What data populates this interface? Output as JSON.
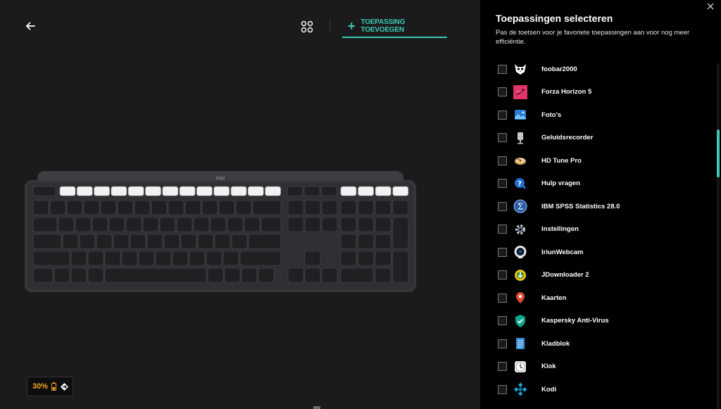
{
  "header": {
    "add_app_label": "TOEPASSING TOEVOEGEN"
  },
  "keyboard": {
    "brand": "logi",
    "image": "keyboard-render",
    "color": "#3a3b3d"
  },
  "battery": {
    "percent": "30%",
    "color": "#f5a623"
  },
  "panel": {
    "title": "Toepassingen selecteren",
    "description": "Pas de toetsen voor je favoriete toepassingen aan voor nog meer efficiëntie.",
    "accent": "#3ec9b7",
    "apps": [
      {
        "name": "foobar2000",
        "icon": "foobar-icon",
        "checked": false
      },
      {
        "name": "Forza Horizon 5",
        "icon": "forza-icon",
        "checked": false
      },
      {
        "name": "Foto's",
        "icon": "photos-icon",
        "checked": false
      },
      {
        "name": "Geluidsrecorder",
        "icon": "recorder-icon",
        "checked": false
      },
      {
        "name": "HD Tune Pro",
        "icon": "hdtune-icon",
        "checked": false
      },
      {
        "name": "Hulp vragen",
        "icon": "help-icon",
        "checked": false
      },
      {
        "name": "IBM SPSS Statistics 28.0",
        "icon": "spss-icon",
        "checked": false
      },
      {
        "name": "Instellingen",
        "icon": "settings-gear-icon",
        "checked": false
      },
      {
        "name": "IriunWebcam",
        "icon": "webcam-icon",
        "checked": false
      },
      {
        "name": "JDownloader 2",
        "icon": "jdownloader-icon",
        "checked": false
      },
      {
        "name": "Kaarten",
        "icon": "maps-pin-icon",
        "checked": false
      },
      {
        "name": "Kaspersky Anti-Virus",
        "icon": "kaspersky-shield-icon",
        "checked": false
      },
      {
        "name": "Kladblok",
        "icon": "notepad-icon",
        "checked": false
      },
      {
        "name": "Klok",
        "icon": "clock-icon",
        "checked": false
      },
      {
        "name": "Kodi",
        "icon": "kodi-icon",
        "checked": false
      }
    ]
  }
}
